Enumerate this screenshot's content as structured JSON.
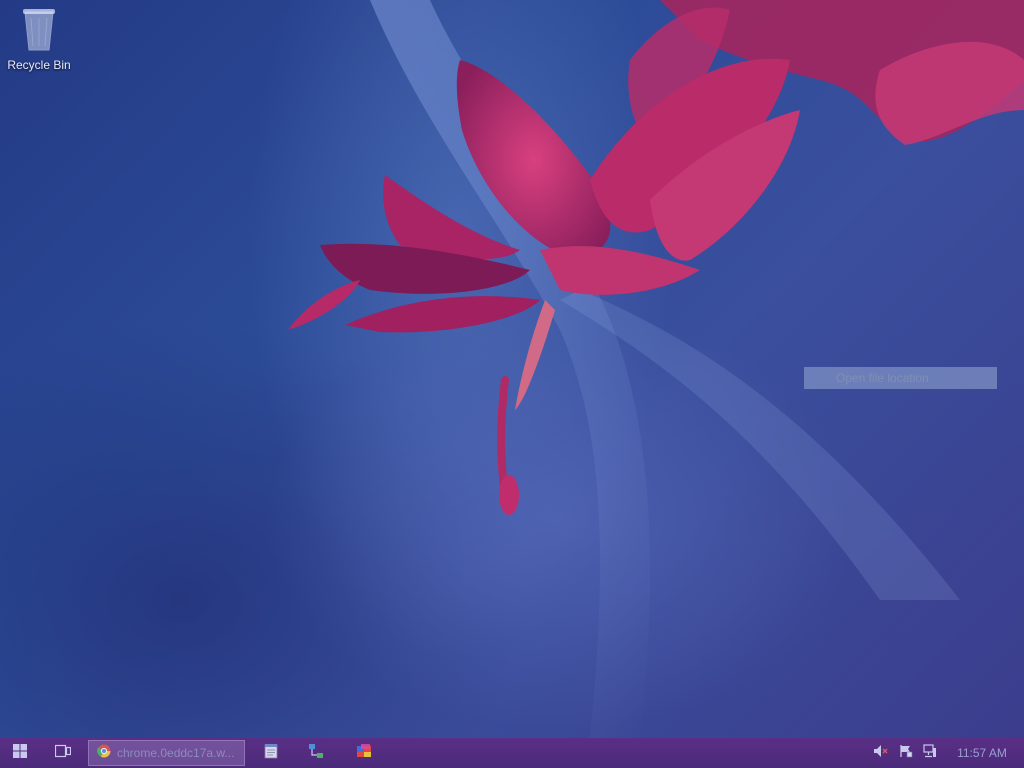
{
  "desktop": {
    "icons": [
      {
        "label": "Recycle Bin",
        "icon": "recycle-bin-icon"
      }
    ]
  },
  "context_menu": {
    "items": [
      {
        "label": "Open file location",
        "state": "highlighted"
      }
    ]
  },
  "taskbar": {
    "start_icon": "windows-logo-icon",
    "task_view_icon": "task-view-icon",
    "running_apps": [
      {
        "title": "chrome.0eddc17a.w...",
        "icon": "chrome-icon"
      }
    ],
    "pinned_apps": [
      {
        "icon": "notepad-icon"
      },
      {
        "icon": "network-program-icon"
      },
      {
        "icon": "paint-icon"
      }
    ],
    "tray": {
      "icons": [
        "volume-muted-icon",
        "action-center-flag-icon",
        "network-icon"
      ],
      "clock": "11:57 AM"
    }
  },
  "colors": {
    "taskbar": "#4b2a7a",
    "desktop_base": "#2c4c98",
    "flower": "#c2336e"
  }
}
